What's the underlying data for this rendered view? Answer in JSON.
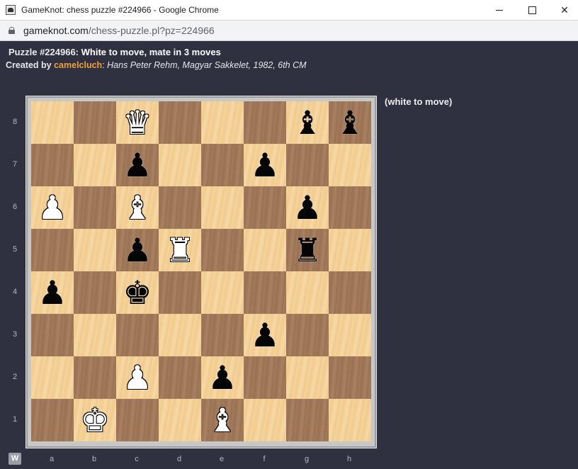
{
  "window": {
    "title": "GameKnot: chess puzzle #224966 - Google Chrome",
    "minimize_label": "",
    "maximize_label": "",
    "close_label": "✕"
  },
  "address": {
    "host": "gameknot.com",
    "path": "/chess-puzzle.pl?pz=224966"
  },
  "puzzle": {
    "number_label": "Puzzle #224966:",
    "task": "White to move, mate in 3 moves",
    "created_by_label": "Created by",
    "author": "camelcluch",
    "colon": ":",
    "source": "Hans Peter Rehm, Magyar Sakkelet, 1982, 6th CM",
    "to_move_note": "(white to move)"
  },
  "board": {
    "ranks": [
      "8",
      "7",
      "6",
      "5",
      "4",
      "3",
      "2",
      "1"
    ],
    "files": [
      "a",
      "b",
      "c",
      "d",
      "e",
      "f",
      "g",
      "h"
    ],
    "flip_label": "W",
    "pieces": [
      {
        "square": "c8",
        "glyph": "♛",
        "color": "w",
        "name": "white-queen"
      },
      {
        "square": "g8",
        "glyph": "♝",
        "color": "b",
        "name": "black-bishop"
      },
      {
        "square": "h8",
        "glyph": "♝",
        "color": "b",
        "name": "black-bishop"
      },
      {
        "square": "c7",
        "glyph": "♟",
        "color": "b",
        "name": "black-pawn"
      },
      {
        "square": "f7",
        "glyph": "♟",
        "color": "b",
        "name": "black-pawn"
      },
      {
        "square": "a6",
        "glyph": "♟",
        "color": "w",
        "name": "white-pawn"
      },
      {
        "square": "c6",
        "glyph": "♝",
        "color": "w",
        "name": "white-bishop"
      },
      {
        "square": "g6",
        "glyph": "♟",
        "color": "b",
        "name": "black-pawn"
      },
      {
        "square": "c5",
        "glyph": "♟",
        "color": "b",
        "name": "black-pawn"
      },
      {
        "square": "d5",
        "glyph": "♜",
        "color": "w",
        "name": "white-rook"
      },
      {
        "square": "g5",
        "glyph": "♜",
        "color": "b",
        "name": "black-rook"
      },
      {
        "square": "a4",
        "glyph": "♟",
        "color": "b",
        "name": "black-pawn"
      },
      {
        "square": "c4",
        "glyph": "♚",
        "color": "b",
        "name": "black-king"
      },
      {
        "square": "f3",
        "glyph": "♟",
        "color": "b",
        "name": "black-pawn"
      },
      {
        "square": "c2",
        "glyph": "♟",
        "color": "w",
        "name": "white-pawn"
      },
      {
        "square": "e2",
        "glyph": "♟",
        "color": "b",
        "name": "black-pawn"
      },
      {
        "square": "b1",
        "glyph": "♚",
        "color": "w",
        "name": "white-king"
      },
      {
        "square": "e1",
        "glyph": "♝",
        "color": "w",
        "name": "white-bishop"
      }
    ]
  },
  "colors": {
    "background": "#2f3140",
    "author_link": "#f0a030",
    "light_square": "#f5d49c",
    "dark_square": "#a37b5d"
  }
}
